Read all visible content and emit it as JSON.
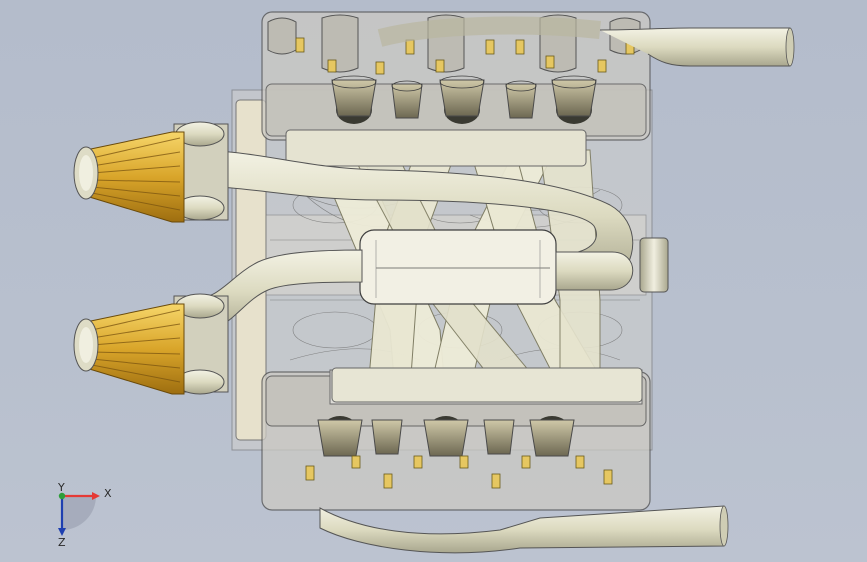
{
  "viewport": {
    "background_color": "#b8c0ce",
    "model": "v8-engine-top-view"
  },
  "triad": {
    "x_label": "X",
    "y_label": "Y",
    "z_label": "Z",
    "x_color": "#e53935",
    "y_color": "#2e9d3a",
    "z_color": "#1e3fb0"
  },
  "colors": {
    "filter_gold": "#d9a52a",
    "pipe_cream": "#e4e2c8",
    "casting_gray": "#8c8c8c",
    "casting_tan": "#d8cba7"
  }
}
